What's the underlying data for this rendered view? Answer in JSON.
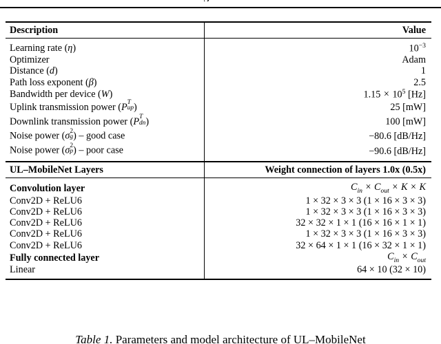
{
  "page": {
    "clipped_glyph": "g"
  },
  "table": {
    "header1": {
      "description": "Description",
      "value": "Value"
    },
    "params": [
      {
        "desc_text": "Learning rate",
        "desc_sym": "η",
        "value": "10",
        "value_sup": "−3",
        "kind": "power"
      },
      {
        "desc_text": "Optimizer",
        "desc_sym": "",
        "value": "Adam",
        "kind": "plain"
      },
      {
        "desc_text": "Distance",
        "desc_sym": "d",
        "value": "1",
        "kind": "plain"
      },
      {
        "desc_text": "Path loss exponent",
        "desc_sym": "β",
        "value": "2.5",
        "kind": "plain"
      },
      {
        "desc_text": "Bandwidth per device",
        "desc_sym": "W",
        "value_mantissa": "1.15",
        "value_base": "10",
        "value_exp": "5",
        "value_unit": "[Hz]",
        "kind": "sci"
      },
      {
        "desc_text": "Uplink transmission power",
        "desc_sym_base": "P",
        "desc_sym_sup": "T",
        "desc_sym_sub": "up",
        "value": "25 [mW]",
        "kind": "supsub"
      },
      {
        "desc_text": "Downlink transmission power",
        "desc_sym_base": "P",
        "desc_sym_sup": "T",
        "desc_sym_sub": "dn",
        "value": "100 [mW]",
        "kind": "supsub"
      },
      {
        "desc_text": "Noise power",
        "desc_sym_base": "σ",
        "desc_sym_sup": "2",
        "desc_sym_sub": "g",
        "desc_suffix": " – good case",
        "value": "−80.6 [dB/Hz]",
        "kind": "sigma"
      },
      {
        "desc_text": "Noise power",
        "desc_sym_base": "σ",
        "desc_sym_sup": "2",
        "desc_sym_sub": "p",
        "desc_suffix": " – poor case",
        "value": "−90.6 [dB/Hz]",
        "kind": "sigma"
      }
    ],
    "header2": {
      "layers": "UL–MobileNet Layers",
      "weights": "Weight connection of layers 1.0x (0.5x)"
    },
    "conv_section_label": "Convolution layer",
    "conv_section_formula_parts": {
      "c_in": "C",
      "c_in_sub": "in",
      "c_out": "C",
      "c_out_sub": "out",
      "k1": "K",
      "k2": "K",
      "times": "×"
    },
    "conv_rows": [
      {
        "label": "Conv2D + ReLU6",
        "weights": "1 × 32 × 3 × 3 (1 × 16 × 3 × 3)"
      },
      {
        "label": "Conv2D + ReLU6",
        "weights": "1 × 32 × 3 × 3 (1 × 16 × 3 × 3)"
      },
      {
        "label": "Conv2D + ReLU6",
        "weights": "32 × 32 × 1 × 1 (16 × 16 × 1 × 1)"
      },
      {
        "label": "Conv2D + ReLU6",
        "weights": "1 × 32 × 3 × 3 (1 × 16 × 3 × 3)"
      },
      {
        "label": "Conv2D + ReLU6",
        "weights": "32 × 64 × 1 × 1 (16 × 32 × 1 × 1)"
      }
    ],
    "fc_section_label": "Fully connected layer",
    "fc_rows": [
      {
        "label": "Linear",
        "weights": "64 × 10 (32 × 10)"
      }
    ]
  },
  "caption": {
    "label": "Table 1.",
    "text": "Parameters and model architecture of UL–MobileNet"
  }
}
